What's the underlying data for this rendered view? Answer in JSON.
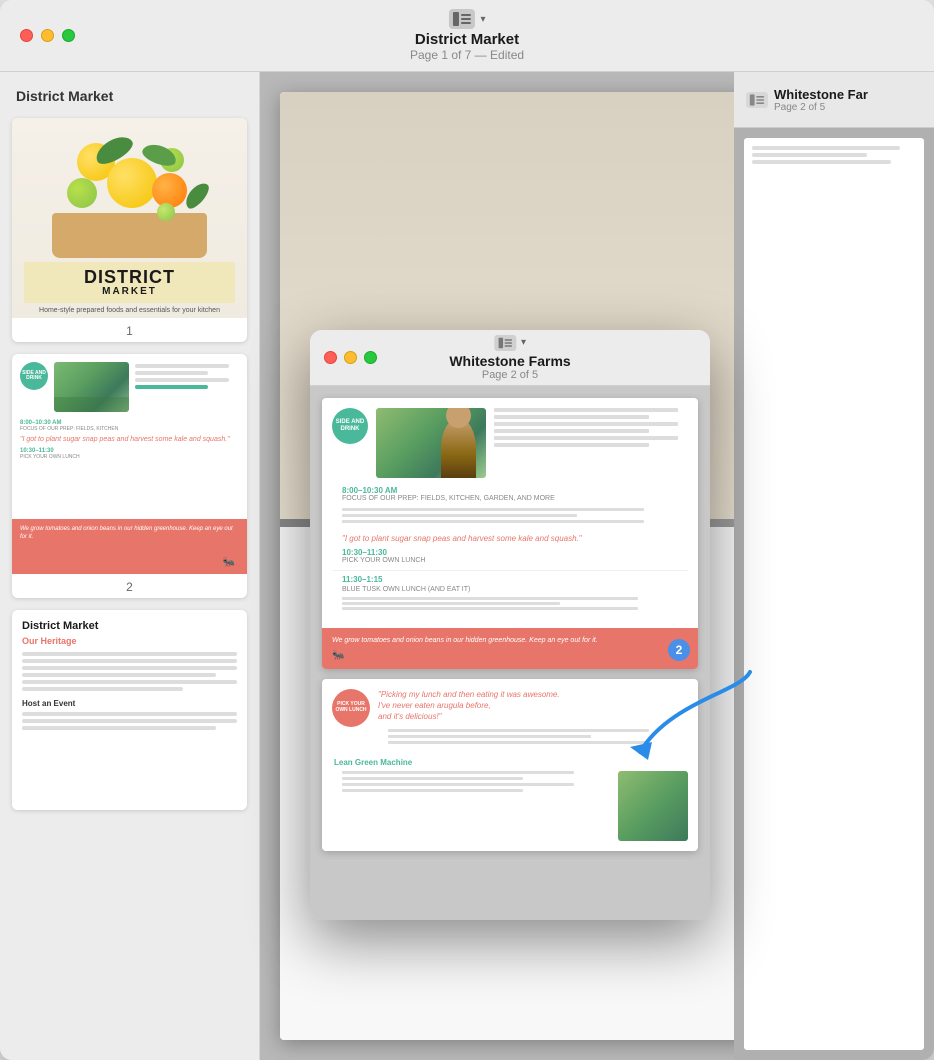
{
  "mainWindow": {
    "title": "District Market",
    "subtitle": "Page 1 of 7 — Edited",
    "sidebarTitle": "District Market",
    "pages": [
      {
        "num": "1",
        "title": "DISTRICT",
        "subtitle": "MARKET",
        "caption": "Home-style prepared foods and essentials for your kitchen"
      },
      {
        "num": "2"
      },
      {
        "num": "3",
        "heading": "District Market",
        "subheading": "Our Heritage",
        "subhead2": "Host an Event"
      }
    ]
  },
  "floatingWindow": {
    "title": "Whitestone Far",
    "titleFull": "Whitestone Farms",
    "subtitle": "Page 2 of 5",
    "badge": {
      "line1": "SIDE AND",
      "line2": "DRINK"
    },
    "timeSection1": {
      "label": "8:00–10:30 AM",
      "sublabel": "FOCUS OF OUR PREP: FIELDS, KITCHEN, GARDEN, AND MORE"
    },
    "quote": "\"I got to plant sugar snap peas and harvest some kale and squash.\"",
    "timeSection2": {
      "label": "10:30–11:30",
      "sublabel": "PICK YOUR OWN LUNCH"
    },
    "timeSection3": {
      "label": "11:30–1:15",
      "sublabel": "BLUE TUSK OWN LUNCH (AND EAT IT)"
    },
    "redText": "We grow tomatoes and onion beans in our hidden greenhouse. Keep an eye out for it.",
    "pageNum": "2"
  },
  "wsBgWindow": {
    "title": "Whitestone Far",
    "subtitle": "Page 2 of 5"
  },
  "icons": {
    "sidebar_toggle": "⊞",
    "chevron": "▾"
  }
}
